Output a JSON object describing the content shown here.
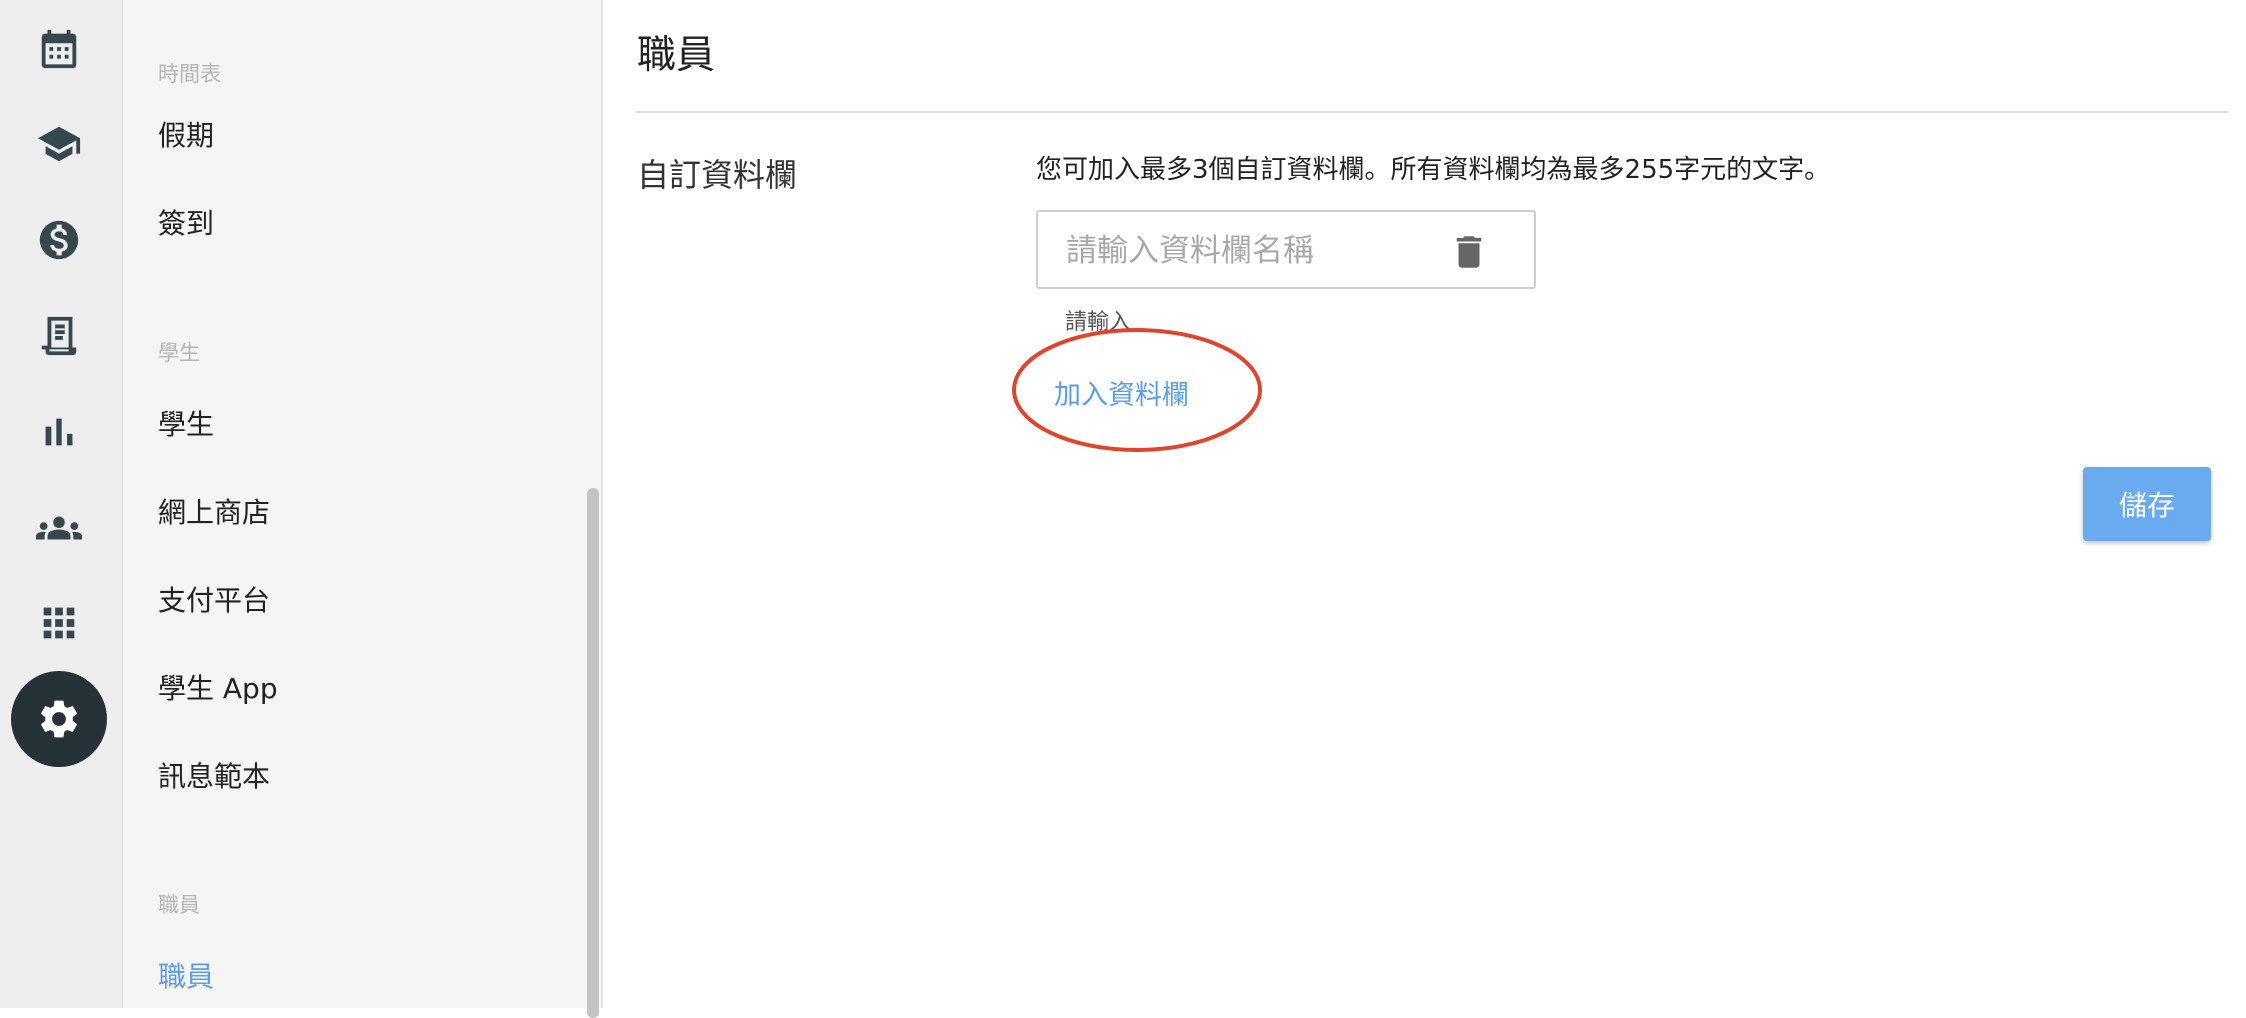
{
  "rail": {
    "items": [
      {
        "icon": "calendar-icon"
      },
      {
        "icon": "graduation-cap-icon"
      },
      {
        "icon": "dollar-icon"
      },
      {
        "icon": "receipt-icon"
      },
      {
        "icon": "bar-chart-icon"
      },
      {
        "icon": "people-icon"
      },
      {
        "icon": "apps-grid-icon"
      },
      {
        "icon": "gear-icon",
        "active": true
      }
    ],
    "icon_color": "#37474f",
    "active_bg": "#263238"
  },
  "menu": {
    "sections": [
      {
        "title": "時間表",
        "items": [
          {
            "label": "假期"
          },
          {
            "label": "簽到"
          }
        ]
      },
      {
        "title": "學生",
        "items": [
          {
            "label": "學生"
          },
          {
            "label": "網上商店"
          },
          {
            "label": "支付平台"
          },
          {
            "label": "學生 App"
          },
          {
            "label": "訊息範本"
          }
        ]
      },
      {
        "title": "職員",
        "items": [
          {
            "label": "職員",
            "active": true
          }
        ]
      }
    ]
  },
  "main": {
    "title": "職員",
    "section_label": "自訂資料欄",
    "description": "您可加入最多3個自訂資料欄。所有資料欄均為最多255字元的文字。",
    "field": {
      "value": "",
      "placeholder": "請輸入資料欄名稱"
    },
    "helper_text": "請輸入",
    "add_field_label": "加入資料欄",
    "save_label": "儲存"
  },
  "colors": {
    "accent": "#5a9fe4",
    "save_button": "#6aaaee",
    "annotation_circle": "#e0442c"
  }
}
